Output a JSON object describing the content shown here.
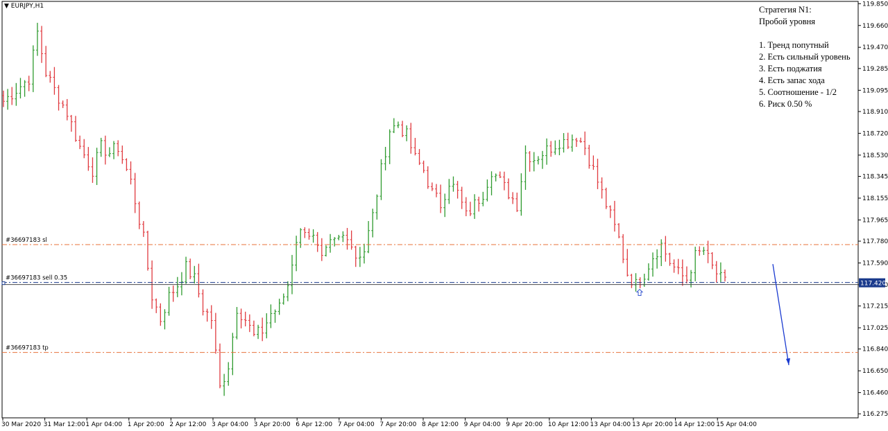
{
  "chart_data": {
    "type": "candlestick",
    "symbol_label": "EURJPY,H1",
    "ylim": [
      116.24,
      119.87
    ],
    "y_ticks": [
      "119.850",
      "119.660",
      "119.470",
      "119.285",
      "119.095",
      "118.910",
      "118.720",
      "118.530",
      "118.345",
      "118.155",
      "117.965",
      "117.780",
      "117.590",
      "117.400",
      "117.215",
      "117.025",
      "116.840",
      "116.650",
      "116.460",
      "116.275"
    ],
    "x_ticks": [
      "30 Mar 2020",
      "31 Mar 12:00",
      "1 Apr 04:00",
      "1 Apr 20:00",
      "2 Apr 12:00",
      "3 Apr 04:00",
      "3 Apr 20:00",
      "6 Apr 12:00",
      "7 Apr 04:00",
      "7 Apr 20:00",
      "8 Apr 12:00",
      "9 Apr 04:00",
      "9 Apr 20:00",
      "10 Apr 12:00",
      "13 Apr 04:00",
      "13 Apr 20:00",
      "14 Apr 12:00",
      "15 Apr 04:00"
    ],
    "current_price": "117.420",
    "up_color": "#2e9a2e",
    "down_color": "#e0393e",
    "orders": [
      {
        "label": "#36697183 sl",
        "price": 117.75,
        "color": "#e8703a"
      },
      {
        "label": "#36697183 sell 0.35",
        "price": 117.42,
        "color": "#1a3a8c"
      },
      {
        "label": "#36697183 tp",
        "price": 116.81,
        "color": "#e8703a"
      }
    ],
    "close_path": [
      [
        0,
        119.0
      ],
      [
        3,
        119.1
      ],
      [
        6,
        119.2
      ],
      [
        8,
        119.6
      ],
      [
        10,
        119.25
      ],
      [
        12,
        119.1
      ],
      [
        15,
        118.9
      ],
      [
        18,
        118.6
      ],
      [
        21,
        118.4
      ],
      [
        23,
        118.6
      ],
      [
        25,
        118.55
      ],
      [
        27,
        118.6
      ],
      [
        30,
        118.3
      ],
      [
        33,
        117.8
      ],
      [
        35,
        117.3
      ],
      [
        37,
        117.1
      ],
      [
        39,
        117.3
      ],
      [
        41,
        117.4
      ],
      [
        43,
        117.55
      ],
      [
        45,
        117.45
      ],
      [
        47,
        117.2
      ],
      [
        49,
        117.1
      ],
      [
        51,
        116.5
      ],
      [
        53,
        116.7
      ],
      [
        55,
        117.2
      ],
      [
        57,
        117.1
      ],
      [
        59,
        116.95
      ],
      [
        61,
        117.0
      ],
      [
        63,
        117.15
      ],
      [
        65,
        117.2
      ],
      [
        67,
        117.4
      ],
      [
        69,
        117.8
      ],
      [
        71,
        117.9
      ],
      [
        73,
        117.8
      ],
      [
        75,
        117.6
      ],
      [
        77,
        117.75
      ],
      [
        79,
        117.8
      ],
      [
        81,
        117.85
      ],
      [
        83,
        117.65
      ],
      [
        85,
        117.7
      ],
      [
        87,
        118.0
      ],
      [
        89,
        118.4
      ],
      [
        91,
        118.75
      ],
      [
        93,
        118.8
      ],
      [
        95,
        118.7
      ],
      [
        97,
        118.5
      ],
      [
        99,
        118.4
      ],
      [
        101,
        118.2
      ],
      [
        103,
        118.1
      ],
      [
        105,
        118.3
      ],
      [
        107,
        118.2
      ],
      [
        109,
        118.0
      ],
      [
        111,
        118.1
      ],
      [
        113,
        118.2
      ],
      [
        115,
        118.4
      ],
      [
        117,
        118.3
      ],
      [
        119,
        118.2
      ],
      [
        121,
        118.1
      ],
      [
        123,
        118.55
      ],
      [
        125,
        118.5
      ],
      [
        127,
        118.55
      ],
      [
        129,
        118.6
      ],
      [
        131,
        118.65
      ],
      [
        133,
        118.65
      ],
      [
        135,
        118.7
      ],
      [
        137,
        118.6
      ],
      [
        139,
        118.4
      ],
      [
        141,
        118.2
      ],
      [
        143,
        118.0
      ],
      [
        145,
        117.8
      ],
      [
        147,
        117.5
      ],
      [
        149,
        117.4
      ],
      [
        151,
        117.5
      ],
      [
        153,
        117.65
      ],
      [
        155,
        117.75
      ],
      [
        157,
        117.6
      ],
      [
        159,
        117.5
      ],
      [
        161,
        117.45
      ],
      [
        163,
        117.65
      ],
      [
        165,
        117.7
      ],
      [
        167,
        117.55
      ],
      [
        169,
        117.45
      ],
      [
        170,
        117.42
      ]
    ]
  },
  "strategy": {
    "title": "Стратегия N1:",
    "subtitle": "Пробой уровня",
    "rules": [
      "1. Тренд попутный",
      "2. Есть сильный уровень",
      "3. Есть поджатия",
      "4. Есть запас хода",
      "5. Соотношение - 1/2",
      "6. Риск 0.50 %"
    ]
  }
}
